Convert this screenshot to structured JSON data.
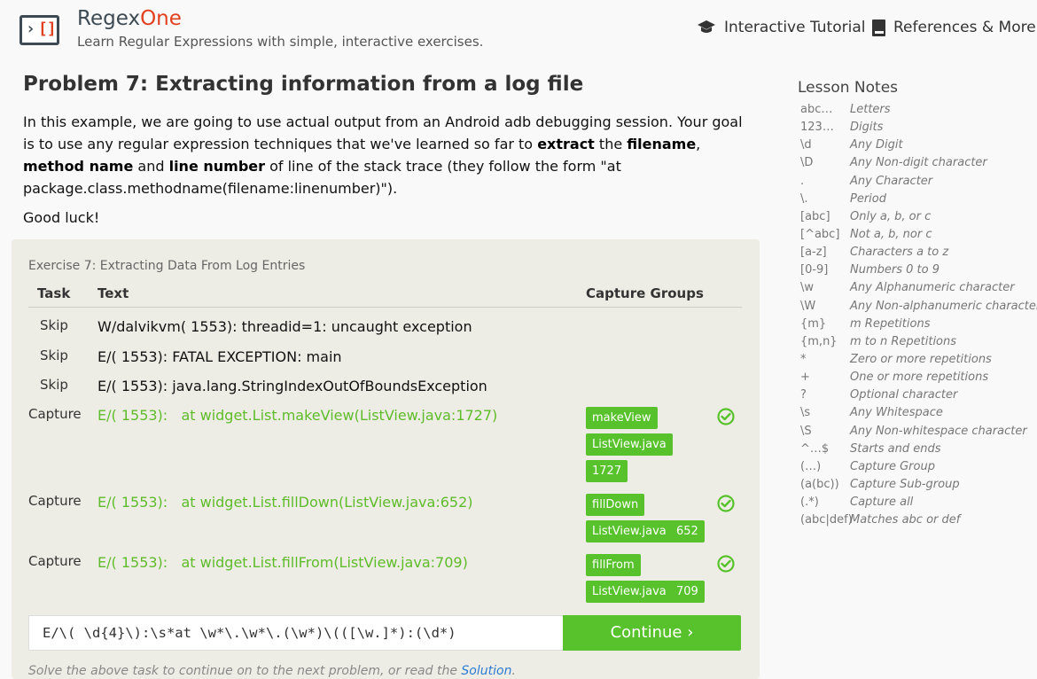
{
  "header": {
    "brand_main": "Regex",
    "brand_accent": "One",
    "tagline": "Learn Regular Expressions with simple, interactive exercises.",
    "nav": {
      "tutorial": "Interactive Tutorial",
      "references": "References & More"
    }
  },
  "lesson": {
    "title": "Problem 7: Extracting information from a log file",
    "desc_1": "In this example, we are going to use actual output from an Android adb debugging session. Your goal is to use any regular expression techniques that we've learned so far to ",
    "desc_extract": "extract",
    "desc_2": " the ",
    "desc_filename": "filename",
    "desc_3": ", ",
    "desc_method": "method name",
    "desc_4": " and ",
    "desc_line": "line number",
    "desc_5": " of line of the stack trace (they follow the form \"at package.class.methodname(filename:linenumber)\").",
    "good_luck": "Good luck!"
  },
  "exercise": {
    "title": "Exercise 7: Extracting Data From Log Entries",
    "headers": {
      "task": "Task",
      "text": "Text",
      "capture": "Capture Groups"
    },
    "rows": [
      {
        "task": "Skip",
        "text": "W/dalvikvm( 1553): threadid=1: uncaught exception"
      },
      {
        "task": "Skip",
        "text": "E/( 1553): FATAL EXCEPTION: main"
      },
      {
        "task": "Skip",
        "text": "E/( 1553): java.lang.StringIndexOutOfBoundsException"
      },
      {
        "task": "Capture",
        "text": "E/( 1553):   at widget.List.makeView(ListView.java:1727)",
        "groups": [
          "makeView",
          "ListView.java",
          "1727"
        ]
      },
      {
        "task": "Capture",
        "text": "E/( 1553):   at widget.List.fillDown(ListView.java:652)",
        "groups": [
          "fillDown",
          "ListView.java",
          "652"
        ]
      },
      {
        "task": "Capture",
        "text": "E/( 1553):   at widget.List.fillFrom(ListView.java:709)",
        "groups": [
          "fillFrom",
          "ListView.java",
          "709"
        ]
      }
    ],
    "regex_value": "E/\\( \\d{4}\\):\\s*at \\w*\\.\\w*\\.(\\w*)\\(([\\w.]*):(\\d*)",
    "continue_label": "Continue ›",
    "footer_text": "Solve the above task to continue on to the next problem, or read the ",
    "footer_link": "Solution",
    "footer_end": "."
  },
  "notes": {
    "title": "Lesson Notes",
    "items": [
      {
        "k": "abc…",
        "v": "Letters"
      },
      {
        "k": "123…",
        "v": "Digits"
      },
      {
        "k": "\\d",
        "v": "Any Digit"
      },
      {
        "k": "\\D",
        "v": "Any Non-digit character"
      },
      {
        "k": ".",
        "v": "Any Character"
      },
      {
        "k": "\\.",
        "v": "Period"
      },
      {
        "k": "[abc]",
        "v": "Only a, b, or c"
      },
      {
        "k": "[^abc]",
        "v": "Not a, b, nor c"
      },
      {
        "k": "[a-z]",
        "v": "Characters a to z"
      },
      {
        "k": "[0-9]",
        "v": "Numbers 0 to 9"
      },
      {
        "k": "\\w",
        "v": "Any Alphanumeric character"
      },
      {
        "k": "\\W",
        "v": "Any Non-alphanumeric character"
      },
      {
        "k": "{m}",
        "v": "m Repetitions"
      },
      {
        "k": "{m,n}",
        "v": "m to n Repetitions"
      },
      {
        "k": "*",
        "v": "Zero or more repetitions"
      },
      {
        "k": "+",
        "v": "One or more repetitions"
      },
      {
        "k": "?",
        "v": "Optional character"
      },
      {
        "k": "\\s",
        "v": "Any Whitespace"
      },
      {
        "k": "\\S",
        "v": "Any Non-whitespace character"
      },
      {
        "k": "^…$",
        "v": "Starts and ends"
      },
      {
        "k": "(…)",
        "v": "Capture Group"
      },
      {
        "k": "(a(bc))",
        "v": "Capture Sub-group"
      },
      {
        "k": "(.*)",
        "v": "Capture all"
      },
      {
        "k": "(abc|def)",
        "v": "Matches abc or def"
      }
    ]
  },
  "colors": {
    "accent_green": "#57c22b",
    "brand_orange": "#e1401f",
    "link_blue": "#2a7bd4"
  },
  "icons": {
    "tutorial": "graduation-cap-icon",
    "references": "book-icon",
    "success": "check-circle-icon"
  }
}
